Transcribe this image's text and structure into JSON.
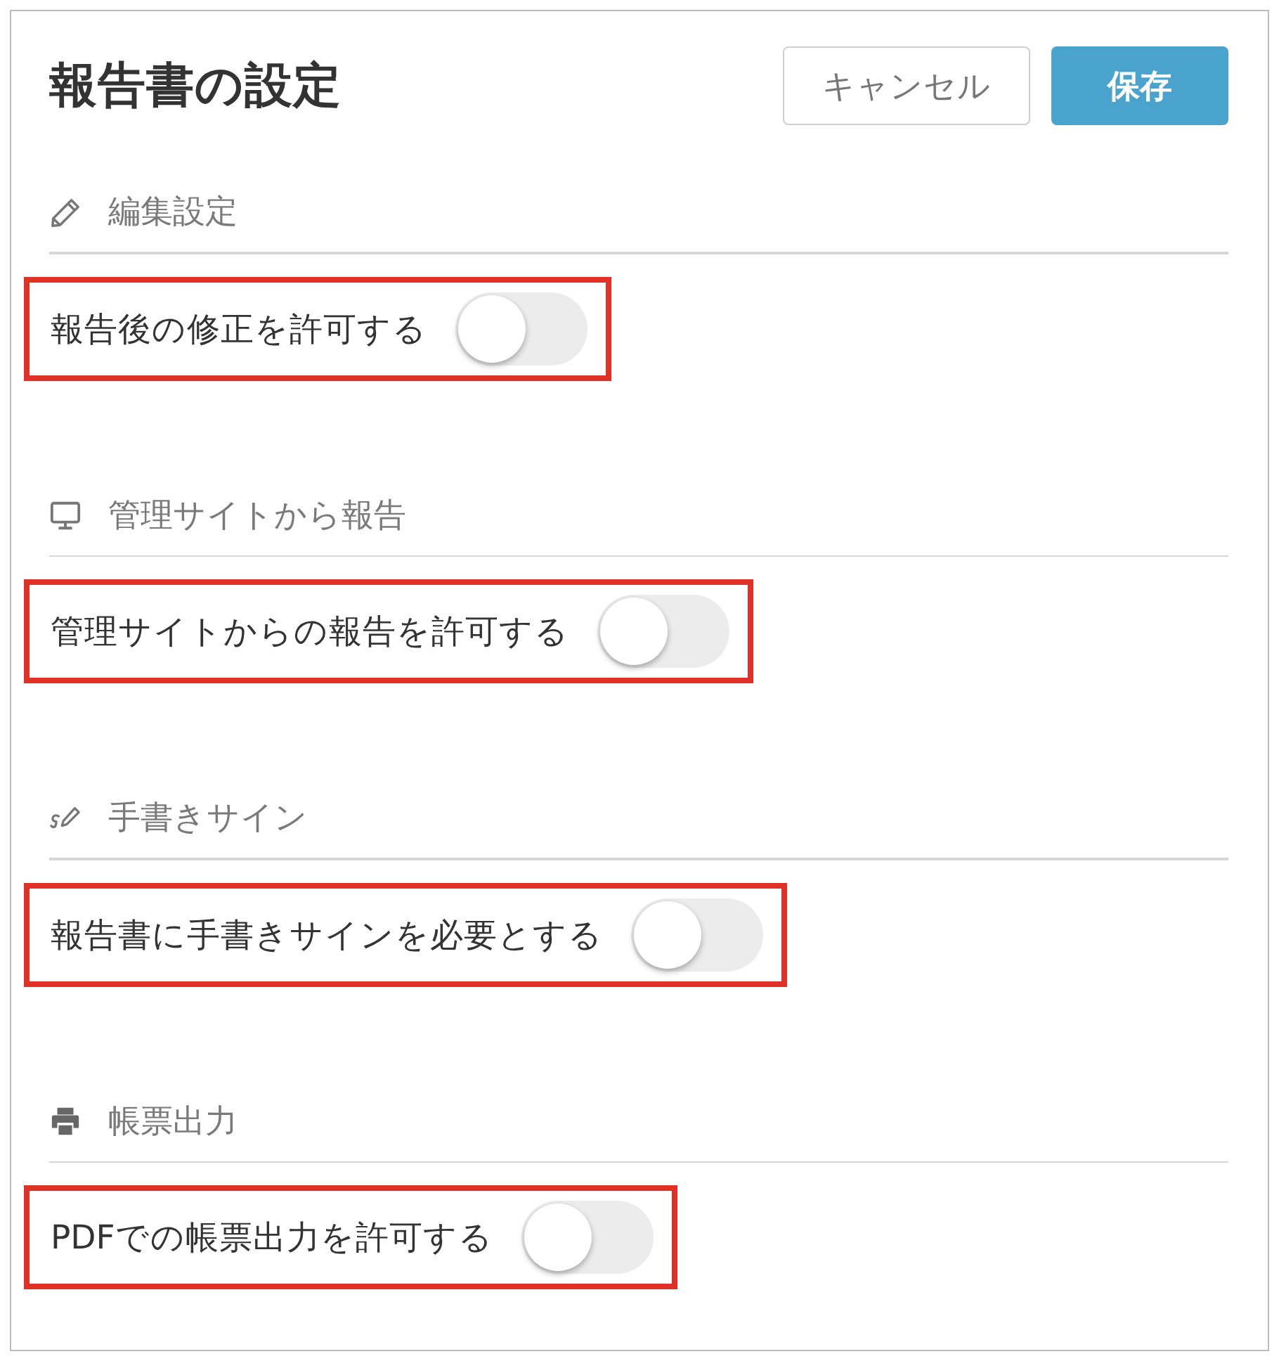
{
  "dialog": {
    "title": "報告書の設定"
  },
  "buttons": [
    {
      "label": "キャンセル",
      "kind": "secondary"
    },
    {
      "label": "保存",
      "kind": "primary"
    }
  ],
  "sections": [
    {
      "kind": "edit",
      "title": "編集設定",
      "setting": {
        "label": "報告後の修正を許可する",
        "on": false,
        "highlighted": true
      }
    },
    {
      "kind": "admin-site",
      "title": "管理サイトから報告",
      "setting": {
        "label": "管理サイトからの報告を許可する",
        "on": false,
        "highlighted": true
      }
    },
    {
      "kind": "signature",
      "title": "手書きサイン",
      "setting": {
        "label": "報告書に手書きサインを必要とする",
        "on": false,
        "highlighted": true
      }
    },
    {
      "kind": "print",
      "title": "帳票出力",
      "setting": {
        "label": "PDFでの帳票出力を許可する",
        "on": false,
        "highlighted": true
      }
    }
  ]
}
